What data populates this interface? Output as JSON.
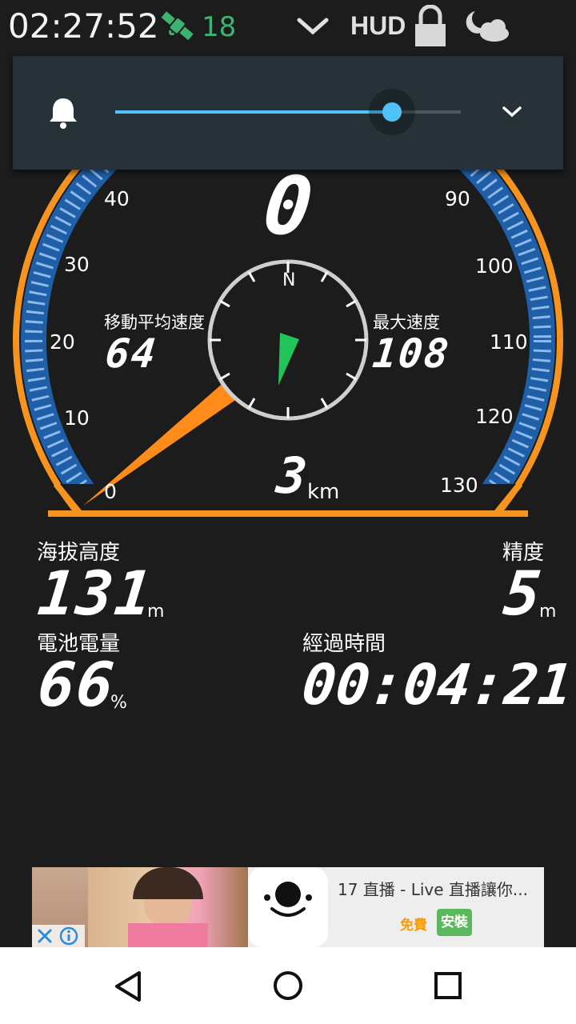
{
  "status_bar": {
    "time": "02:27:52",
    "satellite_icon": "satellite-icon",
    "satellite_count": "18",
    "hud_label": "HUD",
    "icons": [
      "chevron-down-icon",
      "lock-icon",
      "night-weather-icon"
    ]
  },
  "volume": {
    "icon": "bell-icon",
    "level": 0.8,
    "expand_icon": "chevron-down-icon",
    "accent": "#4fc3f7"
  },
  "gauge": {
    "speed": "0",
    "distance_value": "3",
    "distance_unit": "km",
    "avg_speed_label": "移動平均速度",
    "avg_speed": "64",
    "max_speed_label": "最大速度",
    "max_speed": "108",
    "compass_north": "N",
    "ticks_left": [
      "40",
      "30",
      "20",
      "10",
      "0"
    ],
    "ticks_right": [
      "90",
      "100",
      "110",
      "120",
      "130"
    ],
    "needle_color": "#ff8c1a",
    "bezel_color": "#f7941d",
    "scale_color": "#1f5fa8",
    "compass_needle_color": "#21c45a"
  },
  "info": {
    "altitude_label": "海拔高度",
    "altitude_value": "131",
    "altitude_unit": "m",
    "accuracy_label": "精度",
    "accuracy_value": "5",
    "accuracy_unit": "m",
    "battery_label": "電池電量",
    "battery_value": "66",
    "battery_unit": "%",
    "elapsed_label": "經過時間",
    "elapsed_value": "00:04:21"
  },
  "ad": {
    "title": "17 直播 - Live 直播讓你...",
    "free_label": "免費",
    "install_label": "安裝",
    "close_icon": "close-icon",
    "info_icon": "info-icon"
  },
  "nav": {
    "back": "back-icon",
    "home": "home-icon",
    "recents": "recents-icon"
  }
}
